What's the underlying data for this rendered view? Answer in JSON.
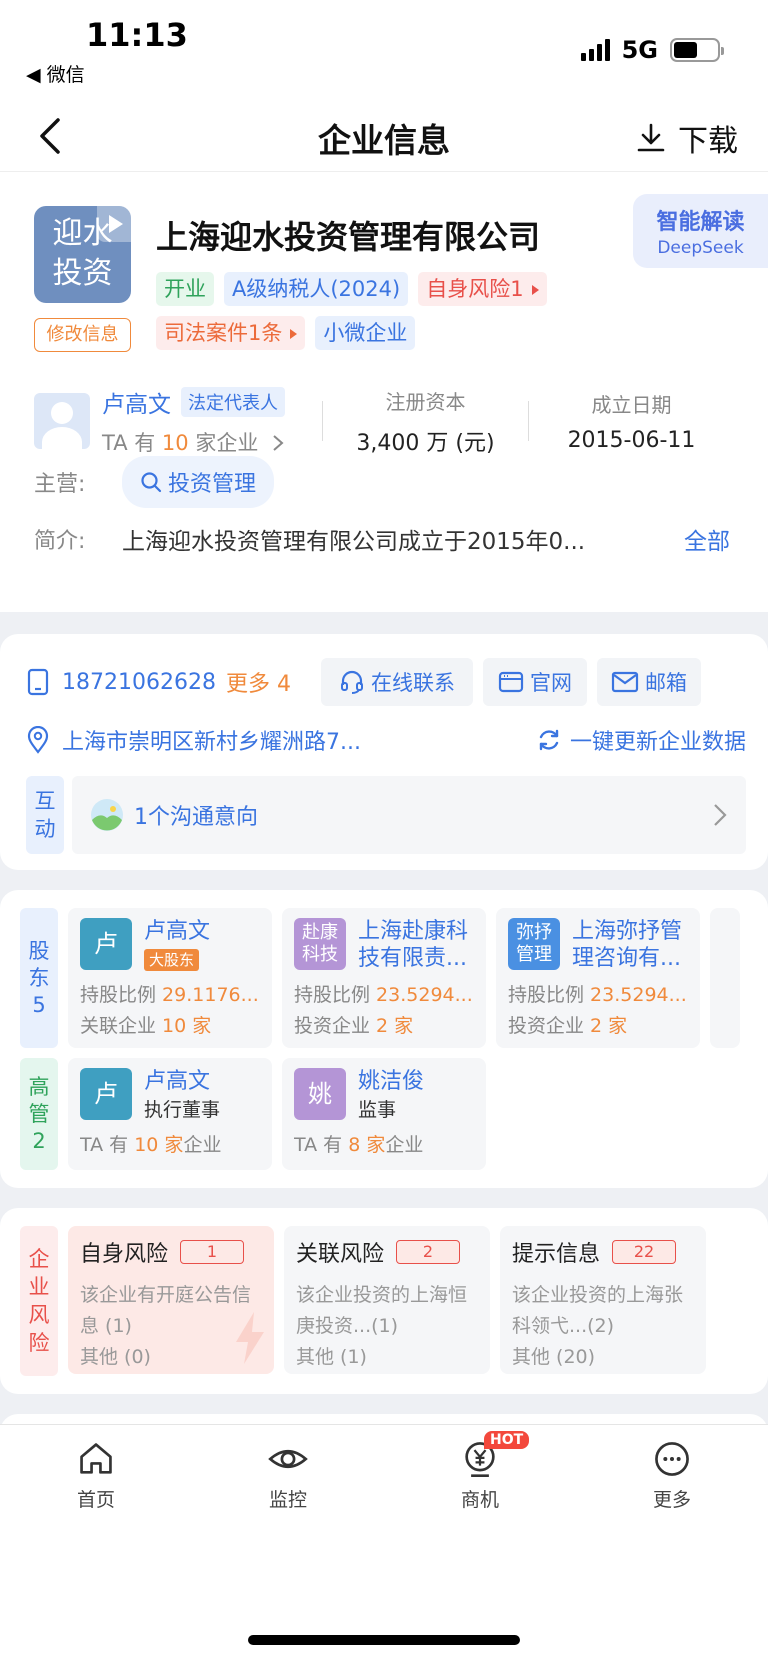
{
  "status": {
    "time": "11:13",
    "back_app": "◀ 微信",
    "network": "5G",
    "battery_level": 0.55
  },
  "nav": {
    "title": "企业信息",
    "download": "下载"
  },
  "company": {
    "logo_text": "迎水\n投资",
    "edit": "修改信息",
    "name": "上海迎水投资管理有限公司",
    "ai": {
      "title": "智能解读",
      "sub": "DeepSeek"
    },
    "tags": [
      {
        "text": "开业",
        "style": "green"
      },
      {
        "text": "A级纳税人(2024)",
        "style": "blue"
      },
      {
        "text": "自身风险1",
        "style": "red",
        "arrow": true
      },
      {
        "text": "司法案件1条",
        "style": "orange",
        "arrow": true
      },
      {
        "text": "小微企业",
        "style": "blue"
      }
    ],
    "legal_person": {
      "name": "卢高文",
      "role": "法定代表人",
      "pre": "TA 有 ",
      "count": "10",
      "post": " 家企业"
    },
    "capital": {
      "label": "注册资本",
      "value": "3,400 万 (元)"
    },
    "founded": {
      "label": "成立日期",
      "value": "2015-06-11"
    },
    "main_label": "主营:",
    "main_chip": "投资管理",
    "intro_label": "简介:",
    "intro": "上海迎水投资管理有限公司成立于2015年0...",
    "intro_all": "全部"
  },
  "contact": {
    "phone": "18721062628",
    "more": "更多 4",
    "online": "在线联系",
    "website": "官网",
    "email": "邮箱",
    "address": "上海市崇明区新村乡耀洲路7...",
    "update": "一键更新企业数据",
    "interact_label": "互\n动",
    "interact_text": "1个沟通意向"
  },
  "shareholders": {
    "label": "股\n东\n5",
    "items": [
      {
        "avatar": "卢",
        "name": "卢高文",
        "badge": "大股东",
        "l1": "持股比例 ",
        "v1": "29.1176...",
        "l2": "关联企业 ",
        "v2": "10 家",
        "color": "teal"
      },
      {
        "avatar": "赴康\n科技",
        "name": "上海赴康科技有限责...",
        "l1": "持股比例 ",
        "v1": "23.5294...",
        "l2": "投资企业 ",
        "v2": "2 家",
        "color": "purple"
      },
      {
        "avatar": "弥抒\n管理",
        "name": "上海弥抒管理咨询有...",
        "l1": "持股比例 ",
        "v1": "23.5294...",
        "l2": "投资企业 ",
        "v2": "2 家",
        "color": "blue"
      }
    ]
  },
  "executives": {
    "label": "高\n管\n2",
    "items": [
      {
        "avatar": "卢",
        "name": "卢高文",
        "role": "执行董事",
        "pre": "TA 有 ",
        "count": "10 家",
        "post": "企业",
        "color": "teal"
      },
      {
        "avatar": "姚",
        "name": "姚洁俊",
        "role": "监事",
        "pre": "TA 有 ",
        "count": "8 家",
        "post": "企业",
        "color": "purple"
      }
    ]
  },
  "risk": {
    "label": "企\n业\n风\n险",
    "items": [
      {
        "title": "自身风险",
        "count": "1",
        "desc": "该企业有开庭公告信息 (1)",
        "other": "其他 (0)"
      },
      {
        "title": "关联风险",
        "count": "2",
        "desc": "该企业投资的上海恒庚投资...(1)",
        "other": "其他 (1)"
      },
      {
        "title": "提示信息",
        "count": "22",
        "desc": "该企业投资的上海张科领弋...(2)",
        "other": "其他 (20)"
      }
    ]
  },
  "tabs": [
    {
      "label": "首页",
      "icon": "home-icon"
    },
    {
      "label": "监控",
      "icon": "eye-icon"
    },
    {
      "label": "商机",
      "icon": "yuan-icon",
      "hot": "HOT"
    },
    {
      "label": "更多",
      "icon": "more-icon"
    }
  ]
}
